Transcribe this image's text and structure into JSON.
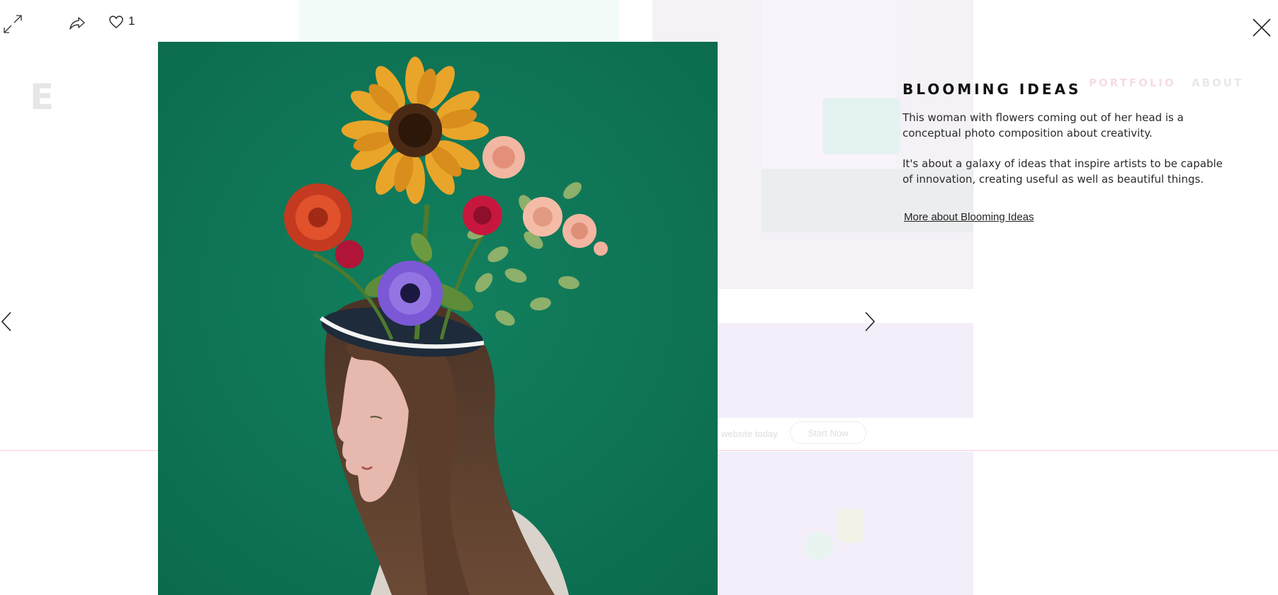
{
  "toolbar": {
    "expand_icon": "expand-arrows-icon",
    "share_icon": "share-icon",
    "like_icon": "heart-icon",
    "like_count": "1",
    "close_icon": "close-x-icon"
  },
  "background_page": {
    "logo_letter": "E",
    "nav": {
      "portfolio": "PORTFOLIO",
      "about": "ABOUT"
    },
    "banner": {
      "text": "website today.",
      "button": "Start Now"
    },
    "colors": {
      "portfolio_nav": "#f6dce6",
      "accent_line": "#fbe3ea"
    }
  },
  "viewer": {
    "artwork_background": "#0f7455",
    "prev_icon": "chevron-left-icon",
    "next_icon": "chevron-right-icon"
  },
  "info": {
    "title": "BLOOMING IDEAS",
    "paragraph1": "This woman with flowers coming out of her head is a conceptual photo composition about creativity.",
    "paragraph2": "It's about a galaxy of ideas that inspire artists to be capable of innovation, creating useful as well as beautiful things.",
    "link": "More about Blooming Ideas"
  }
}
